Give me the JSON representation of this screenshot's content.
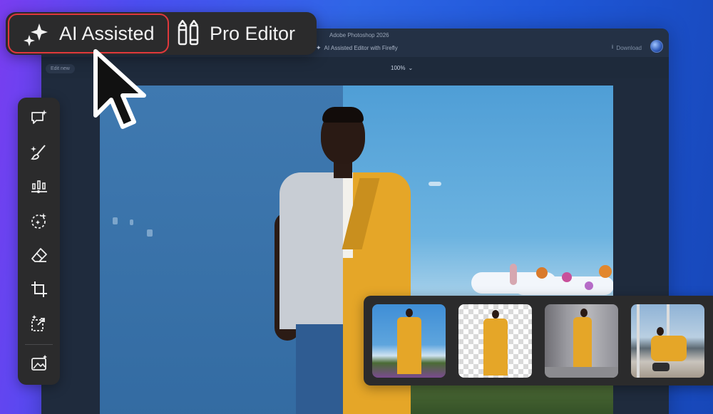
{
  "app": {
    "title": "Adobe Photoshop 2026",
    "subtitle": "AI Assisted Editor with Firefly",
    "download_label": "Download",
    "edit_new_label": "Edit new",
    "zoom_label": "100%"
  },
  "mode_toggle": {
    "ai_label": "AI Assisted",
    "pro_label": "Pro Editor",
    "selected": "AI Assisted"
  },
  "toolbar": {
    "tools": [
      {
        "icon": "chat-sparkle-icon"
      },
      {
        "icon": "brush-sparkle-icon"
      },
      {
        "icon": "adjust-sliders-icon"
      },
      {
        "icon": "select-sparkle-icon"
      },
      {
        "icon": "eraser-icon"
      },
      {
        "icon": "crop-icon"
      },
      {
        "icon": "expand-sparkle-icon"
      },
      {
        "icon": "image-sparkle-icon"
      }
    ]
  },
  "thumbnails": [
    {
      "name": "thumbnail-flower-field"
    },
    {
      "name": "thumbnail-transparent-background"
    },
    {
      "name": "thumbnail-concrete-room"
    },
    {
      "name": "thumbnail-office-chair"
    }
  ],
  "colors": {
    "panel": "#2b2b2c",
    "active_outline": "#e0383b",
    "text": "#f2f2f2",
    "suit": "#e5a628"
  }
}
